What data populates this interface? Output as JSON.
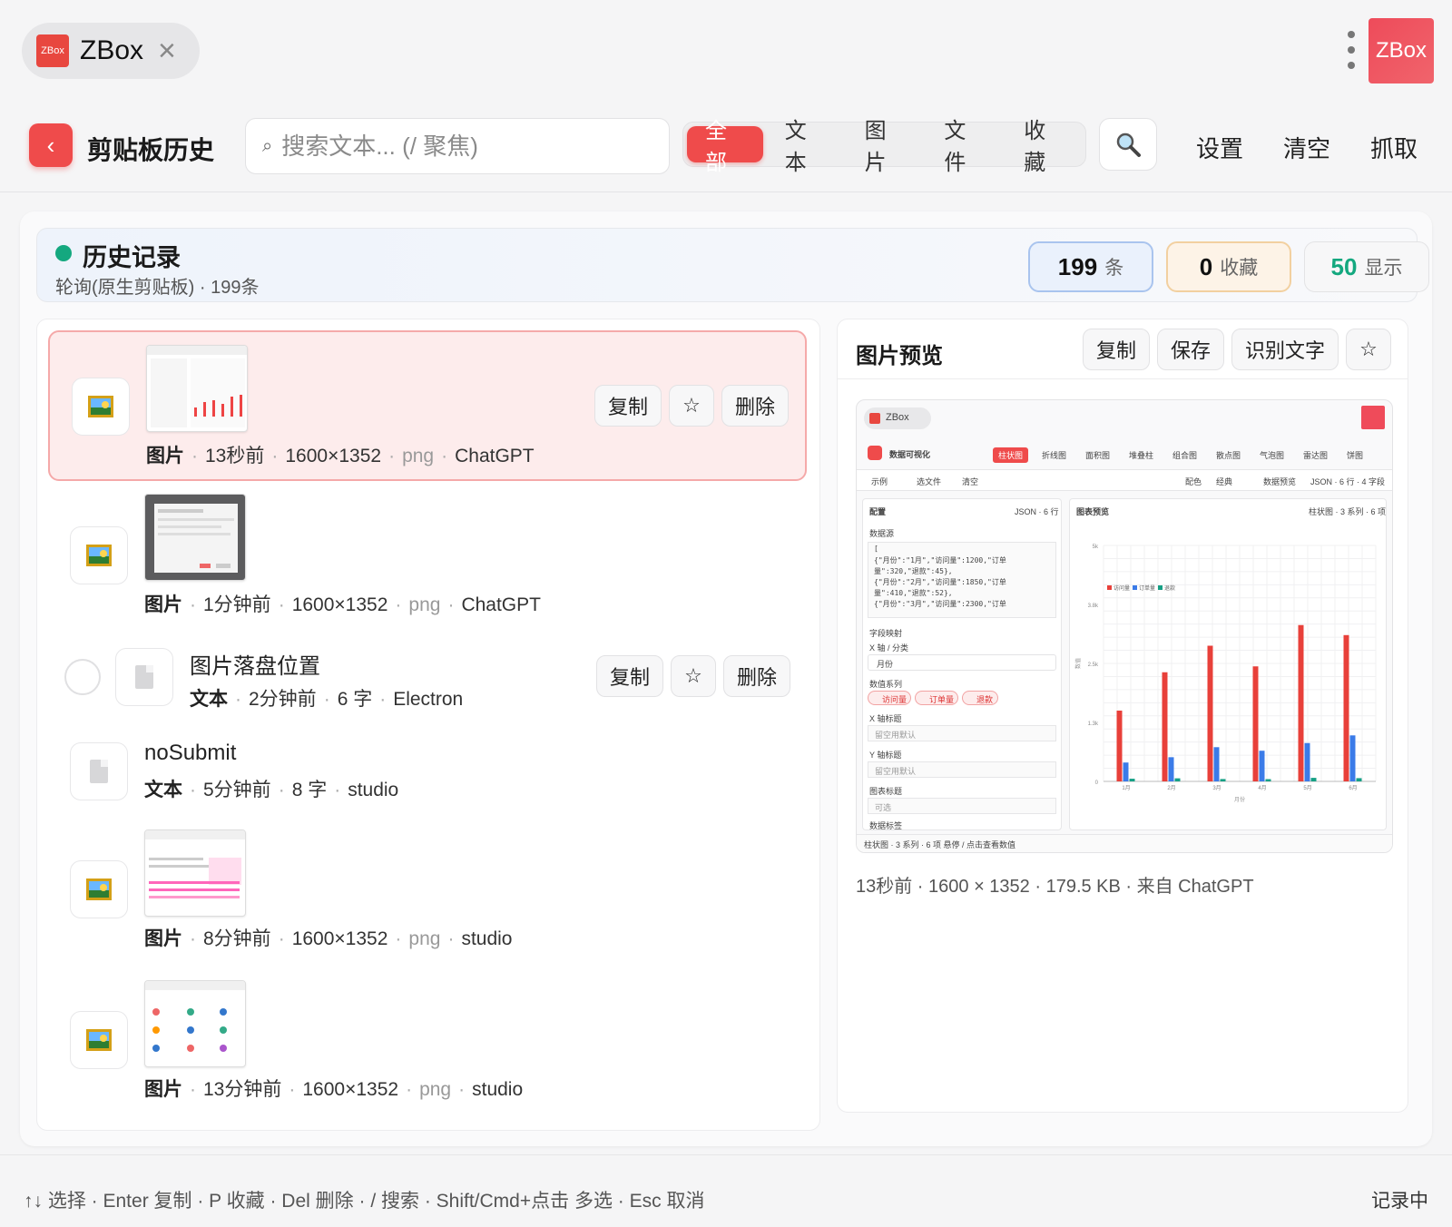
{
  "app": {
    "logo_small": "ZBox",
    "tab_title": "ZBox",
    "brand": "ZBox"
  },
  "toolbar": {
    "title": "剪贴板历史",
    "search_placeholder": "搜索文本... (/ 聚焦)",
    "filters": [
      "全部",
      "文本",
      "图片",
      "文件",
      "收藏"
    ],
    "actions": [
      "设置",
      "清空",
      "抓取"
    ]
  },
  "history": {
    "title": "历史记录",
    "subtitle": "轮询(原生剪贴板) · 199条",
    "stats": [
      {
        "value": "199",
        "unit": "条"
      },
      {
        "value": "0",
        "unit": "收藏"
      },
      {
        "value": "50",
        "unit": "显示"
      }
    ]
  },
  "item_actions": {
    "copy": "复制",
    "star": "☆",
    "delete": "删除"
  },
  "items": [
    {
      "type": "图片",
      "time": "13秒前",
      "size": "1600×1352",
      "ext": "png",
      "source": "ChatGPT"
    },
    {
      "type": "图片",
      "time": "1分钟前",
      "size": "1600×1352",
      "ext": "png",
      "source": "ChatGPT"
    },
    {
      "title": "图片落盘位置",
      "type": "文本",
      "time": "2分钟前",
      "chars": "6 字",
      "source": "Electron"
    },
    {
      "title": "noSubmit",
      "type": "文本",
      "time": "5分钟前",
      "chars": "8 字",
      "source": "studio"
    },
    {
      "type": "图片",
      "time": "8分钟前",
      "size": "1600×1352",
      "ext": "png",
      "source": "studio"
    },
    {
      "type": "图片",
      "time": "13分钟前",
      "size": "1600×1352",
      "ext": "png",
      "source": "studio"
    }
  ],
  "preview": {
    "title": "图片预览",
    "actions": [
      "复制",
      "保存",
      "识别文字",
      "☆"
    ],
    "meta": "13秒前 · 1600 × 1352 · 179.5 KB · 来自 ChatGPT",
    "inner": {
      "tab": "ZBox",
      "title": "数据可视化",
      "chart_tabs": [
        "柱状图",
        "折线图",
        "面积图",
        "堆叠柱",
        "组合图",
        "散点图",
        "气泡图",
        "雷达图",
        "饼图"
      ],
      "sub_left": [
        "示例",
        "选文件",
        "清空"
      ],
      "sub_right": [
        "配色",
        "经典",
        "数据预览",
        "JSON · 6 行 · 4 字段"
      ],
      "config_title": "配置",
      "config_meta": "JSON · 6 行",
      "datasource": "数据源",
      "json_lines": [
        "[",
        "  {\"月份\":\"1月\",\"访问量\":1200,\"订单",
        "量\":320,\"退款\":45},",
        "  {\"月份\":\"2月\",\"访问量\":1850,\"订单",
        "量\":410,\"退款\":52},",
        "  {\"月份\":\"3月\",\"访问量\":2300,\"订单"
      ],
      "field_map": "字段映射",
      "x_label": "X 轴 / 分类",
      "x_value": "月份",
      "series_label": "数值系列",
      "series_chips": [
        "访问量",
        "订单量",
        "退款"
      ],
      "x_title": "X 轴标题",
      "y_title": "Y 轴标题",
      "chart_title": "图表标题",
      "default_ph": "留空用默认",
      "optional_ph": "可选",
      "data_label": "数据标签",
      "preview_title": "图表预览",
      "preview_meta": "柱状图 · 3 系列 · 6 项",
      "status": "柱状图 · 3 系列 · 6 项  悬停 / 点击查看数值",
      "y_axis_name": "数值",
      "x_axis_name": "月份"
    }
  },
  "chart_data": {
    "type": "bar",
    "title": "",
    "categories": [
      "1月",
      "2月",
      "3月",
      "4月",
      "5月",
      "6月"
    ],
    "series": [
      {
        "name": "访问量",
        "color": "#e8403a",
        "values": [
          1200,
          1850,
          2300,
          1950,
          2650,
          2480
        ]
      },
      {
        "name": "订单量",
        "color": "#3b7be8",
        "values": [
          320,
          410,
          580,
          520,
          650,
          780
        ]
      },
      {
        "name": "退款",
        "color": "#16a085",
        "values": [
          45,
          52,
          40,
          38,
          60,
          55
        ]
      }
    ],
    "ylim": [
      0,
      4000
    ],
    "yticks": [
      "0",
      "1.3k",
      "2.5k",
      "3.8k",
      "5k"
    ],
    "legend": "top-left",
    "grid": true
  },
  "footer": {
    "hint": "↑↓ 选择 · Enter 复制 · P 收藏 · Del 删除 · / 搜索 · Shift/Cmd+点击 多选 · Esc 取消",
    "status": "记录中"
  }
}
